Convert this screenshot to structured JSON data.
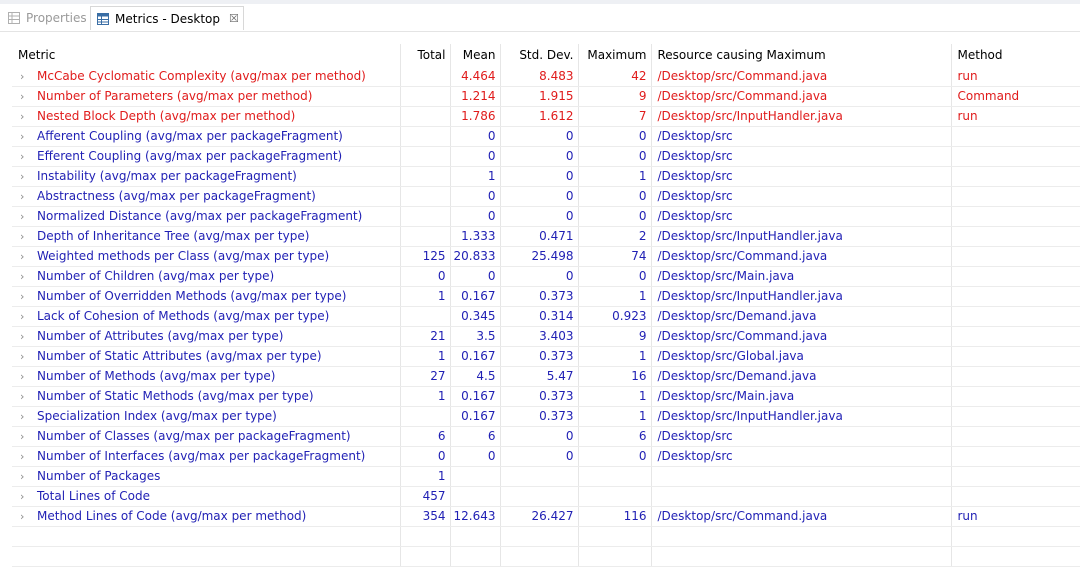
{
  "tabs": {
    "properties_label": "Properties",
    "metrics_label": "Metrics - Desktop",
    "close_glyph": "☒"
  },
  "columns": {
    "metric": "Metric",
    "total": "Total",
    "mean": "Mean",
    "stddev": "Std. Dev.",
    "maximum": "Maximum",
    "resource": "Resource causing Maximum",
    "method": "Method"
  },
  "rows": [
    {
      "metric": "McCabe Cyclomatic Complexity (avg/max per method)",
      "total": "",
      "mean": "4.464",
      "stddev": "8.483",
      "maximum": "42",
      "resource": "/Desktop/src/Command.java",
      "method": "run",
      "color": "red"
    },
    {
      "metric": "Number of Parameters (avg/max per method)",
      "total": "",
      "mean": "1.214",
      "stddev": "1.915",
      "maximum": "9",
      "resource": "/Desktop/src/Command.java",
      "method": "Command",
      "color": "red"
    },
    {
      "metric": "Nested Block Depth (avg/max per method)",
      "total": "",
      "mean": "1.786",
      "stddev": "1.612",
      "maximum": "7",
      "resource": "/Desktop/src/InputHandler.java",
      "method": "run",
      "color": "red"
    },
    {
      "metric": "Afferent Coupling (avg/max per packageFragment)",
      "total": "",
      "mean": "0",
      "stddev": "0",
      "maximum": "0",
      "resource": "/Desktop/src",
      "method": "",
      "color": "blue"
    },
    {
      "metric": "Efferent Coupling (avg/max per packageFragment)",
      "total": "",
      "mean": "0",
      "stddev": "0",
      "maximum": "0",
      "resource": "/Desktop/src",
      "method": "",
      "color": "blue"
    },
    {
      "metric": "Instability (avg/max per packageFragment)",
      "total": "",
      "mean": "1",
      "stddev": "0",
      "maximum": "1",
      "resource": "/Desktop/src",
      "method": "",
      "color": "blue"
    },
    {
      "metric": "Abstractness (avg/max per packageFragment)",
      "total": "",
      "mean": "0",
      "stddev": "0",
      "maximum": "0",
      "resource": "/Desktop/src",
      "method": "",
      "color": "blue"
    },
    {
      "metric": "Normalized Distance (avg/max per packageFragment)",
      "total": "",
      "mean": "0",
      "stddev": "0",
      "maximum": "0",
      "resource": "/Desktop/src",
      "method": "",
      "color": "blue"
    },
    {
      "metric": "Depth of Inheritance Tree (avg/max per type)",
      "total": "",
      "mean": "1.333",
      "stddev": "0.471",
      "maximum": "2",
      "resource": "/Desktop/src/InputHandler.java",
      "method": "",
      "color": "blue"
    },
    {
      "metric": "Weighted methods per Class (avg/max per type)",
      "total": "125",
      "mean": "20.833",
      "stddev": "25.498",
      "maximum": "74",
      "resource": "/Desktop/src/Command.java",
      "method": "",
      "color": "blue"
    },
    {
      "metric": "Number of Children (avg/max per type)",
      "total": "0",
      "mean": "0",
      "stddev": "0",
      "maximum": "0",
      "resource": "/Desktop/src/Main.java",
      "method": "",
      "color": "blue"
    },
    {
      "metric": "Number of Overridden Methods (avg/max per type)",
      "total": "1",
      "mean": "0.167",
      "stddev": "0.373",
      "maximum": "1",
      "resource": "/Desktop/src/InputHandler.java",
      "method": "",
      "color": "blue"
    },
    {
      "metric": "Lack of Cohesion of Methods (avg/max per type)",
      "total": "",
      "mean": "0.345",
      "stddev": "0.314",
      "maximum": "0.923",
      "resource": "/Desktop/src/Demand.java",
      "method": "",
      "color": "blue"
    },
    {
      "metric": "Number of Attributes (avg/max per type)",
      "total": "21",
      "mean": "3.5",
      "stddev": "3.403",
      "maximum": "9",
      "resource": "/Desktop/src/Command.java",
      "method": "",
      "color": "blue"
    },
    {
      "metric": "Number of Static Attributes (avg/max per type)",
      "total": "1",
      "mean": "0.167",
      "stddev": "0.373",
      "maximum": "1",
      "resource": "/Desktop/src/Global.java",
      "method": "",
      "color": "blue"
    },
    {
      "metric": "Number of Methods (avg/max per type)",
      "total": "27",
      "mean": "4.5",
      "stddev": "5.47",
      "maximum": "16",
      "resource": "/Desktop/src/Demand.java",
      "method": "",
      "color": "blue"
    },
    {
      "metric": "Number of Static Methods (avg/max per type)",
      "total": "1",
      "mean": "0.167",
      "stddev": "0.373",
      "maximum": "1",
      "resource": "/Desktop/src/Main.java",
      "method": "",
      "color": "blue"
    },
    {
      "metric": "Specialization Index (avg/max per type)",
      "total": "",
      "mean": "0.167",
      "stddev": "0.373",
      "maximum": "1",
      "resource": "/Desktop/src/InputHandler.java",
      "method": "",
      "color": "blue"
    },
    {
      "metric": "Number of Classes (avg/max per packageFragment)",
      "total": "6",
      "mean": "6",
      "stddev": "0",
      "maximum": "6",
      "resource": "/Desktop/src",
      "method": "",
      "color": "blue"
    },
    {
      "metric": "Number of Interfaces (avg/max per packageFragment)",
      "total": "0",
      "mean": "0",
      "stddev": "0",
      "maximum": "0",
      "resource": "/Desktop/src",
      "method": "",
      "color": "blue"
    },
    {
      "metric": "Number of Packages",
      "total": "1",
      "mean": "",
      "stddev": "",
      "maximum": "",
      "resource": "",
      "method": "",
      "color": "blue"
    },
    {
      "metric": "Total Lines of Code",
      "total": "457",
      "mean": "",
      "stddev": "",
      "maximum": "",
      "resource": "",
      "method": "",
      "color": "blue"
    },
    {
      "metric": "Method Lines of Code (avg/max per method)",
      "total": "354",
      "mean": "12.643",
      "stddev": "26.427",
      "maximum": "116",
      "resource": "/Desktop/src/Command.java",
      "method": "run",
      "color": "blue"
    }
  ],
  "colors": {
    "warning_text": "#e01b1b",
    "normal_text": "#1f1fb4"
  },
  "icons": {
    "properties_tab": "properties-icon",
    "metrics_tab": "table-icon",
    "row_expander": "chevron-right-icon"
  }
}
